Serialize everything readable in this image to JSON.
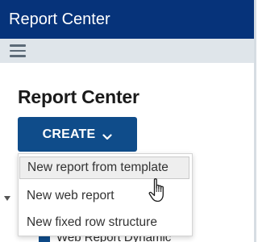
{
  "app": {
    "title": "Report Center"
  },
  "toolbar": {
    "menu_icon": "hamburger-icon"
  },
  "main": {
    "heading": "Report Center",
    "create_button": {
      "label": "CREATE",
      "icon": "chevron-down-icon"
    }
  },
  "dropdown": {
    "items": [
      {
        "label": "New report from template",
        "hovered": true
      },
      {
        "label": "New web report",
        "hovered": false
      },
      {
        "label": "New fixed row structure",
        "hovered": false
      }
    ]
  },
  "tree": {
    "expand_icon": "caret-down-icon",
    "partial_item": "Web Report Dynamic"
  },
  "colors": {
    "title_bar": "#06337a",
    "menu_strip": "#dfe5ea",
    "button": "#0f4c8a",
    "hover_bg": "#eeeeee"
  }
}
